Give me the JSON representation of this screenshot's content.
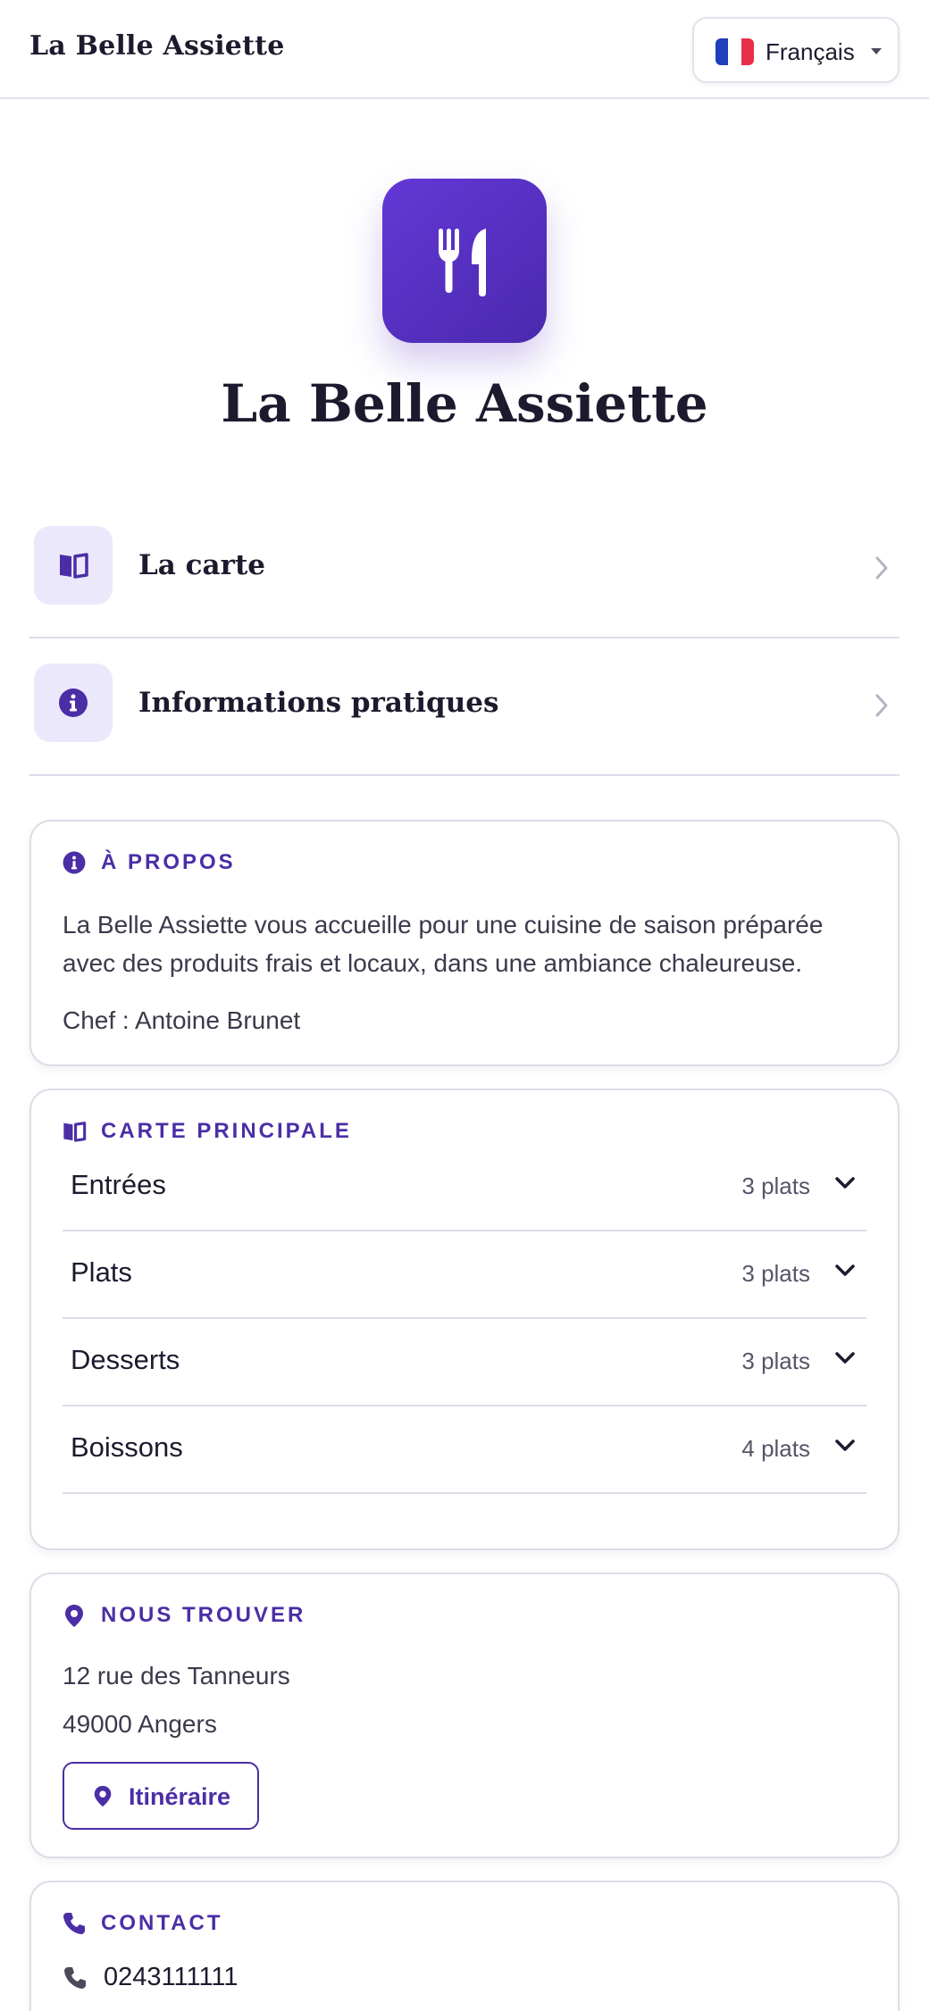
{
  "header": {
    "brand": "La Belle Assiette",
    "language": "Français"
  },
  "hero": {
    "title": "La Belle Assiette"
  },
  "nav": [
    {
      "label": "La carte",
      "icon": "book-icon"
    },
    {
      "label": "Informations pratiques",
      "icon": "info-icon"
    }
  ],
  "about": {
    "heading": "À PROPOS",
    "description_line1": "La Belle Assiette vous accueille pour une cuisine de saison préparée",
    "description_line2": "avec des produits frais et locaux, dans une ambiance chaleureuse.",
    "chef": "Chef : Antoine Brunet"
  },
  "menu": {
    "heading": "CARTE PRINCIPALE",
    "categories": [
      {
        "name": "Entrées",
        "count": "3 plats"
      },
      {
        "name": "Plats",
        "count": "3 plats"
      },
      {
        "name": "Desserts",
        "count": "3 plats"
      },
      {
        "name": "Boissons",
        "count": "4 plats"
      }
    ]
  },
  "location": {
    "heading": "NOUS TROUVER",
    "street": "12 rue des Tanneurs",
    "city": "49000 Angers",
    "route_button": "Itinéraire"
  },
  "contact": {
    "heading": "CONTACT",
    "phone": "0243111111"
  },
  "colors": {
    "accent": "#4b2ea6",
    "accent_light": "#ece8fb",
    "text": "#1c1b2e"
  }
}
